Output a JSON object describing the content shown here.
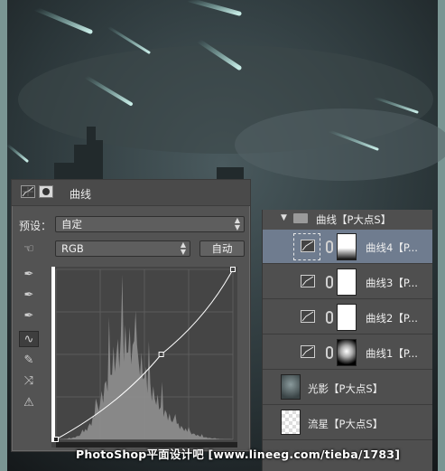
{
  "properties_panel": {
    "title": "曲线",
    "preset_label": "预设：",
    "preset_value": "自定",
    "channel_value": "RGB",
    "auto_button": "自动",
    "curve_points": [
      [
        0.0,
        0.0
      ],
      [
        0.595,
        0.5
      ],
      [
        1.0,
        1.0
      ]
    ]
  },
  "layers_panel": {
    "group_name": "曲线【P大点S】",
    "layers": [
      {
        "name": "曲线4【P...",
        "selected": true,
        "mask": "gradient"
      },
      {
        "name": "曲线3【P...",
        "selected": false,
        "mask": "white"
      },
      {
        "name": "曲线2【P...",
        "selected": false,
        "mask": "white"
      },
      {
        "name": "曲线1【P...",
        "selected": false,
        "mask": "radial"
      }
    ],
    "pixel_layers": [
      {
        "name": "光影【P大点S】"
      },
      {
        "name": "流星【P大点S】"
      }
    ]
  },
  "watermark": "PhotoShop平面设计吧 [www.lineeg.com/tieba/1783]"
}
